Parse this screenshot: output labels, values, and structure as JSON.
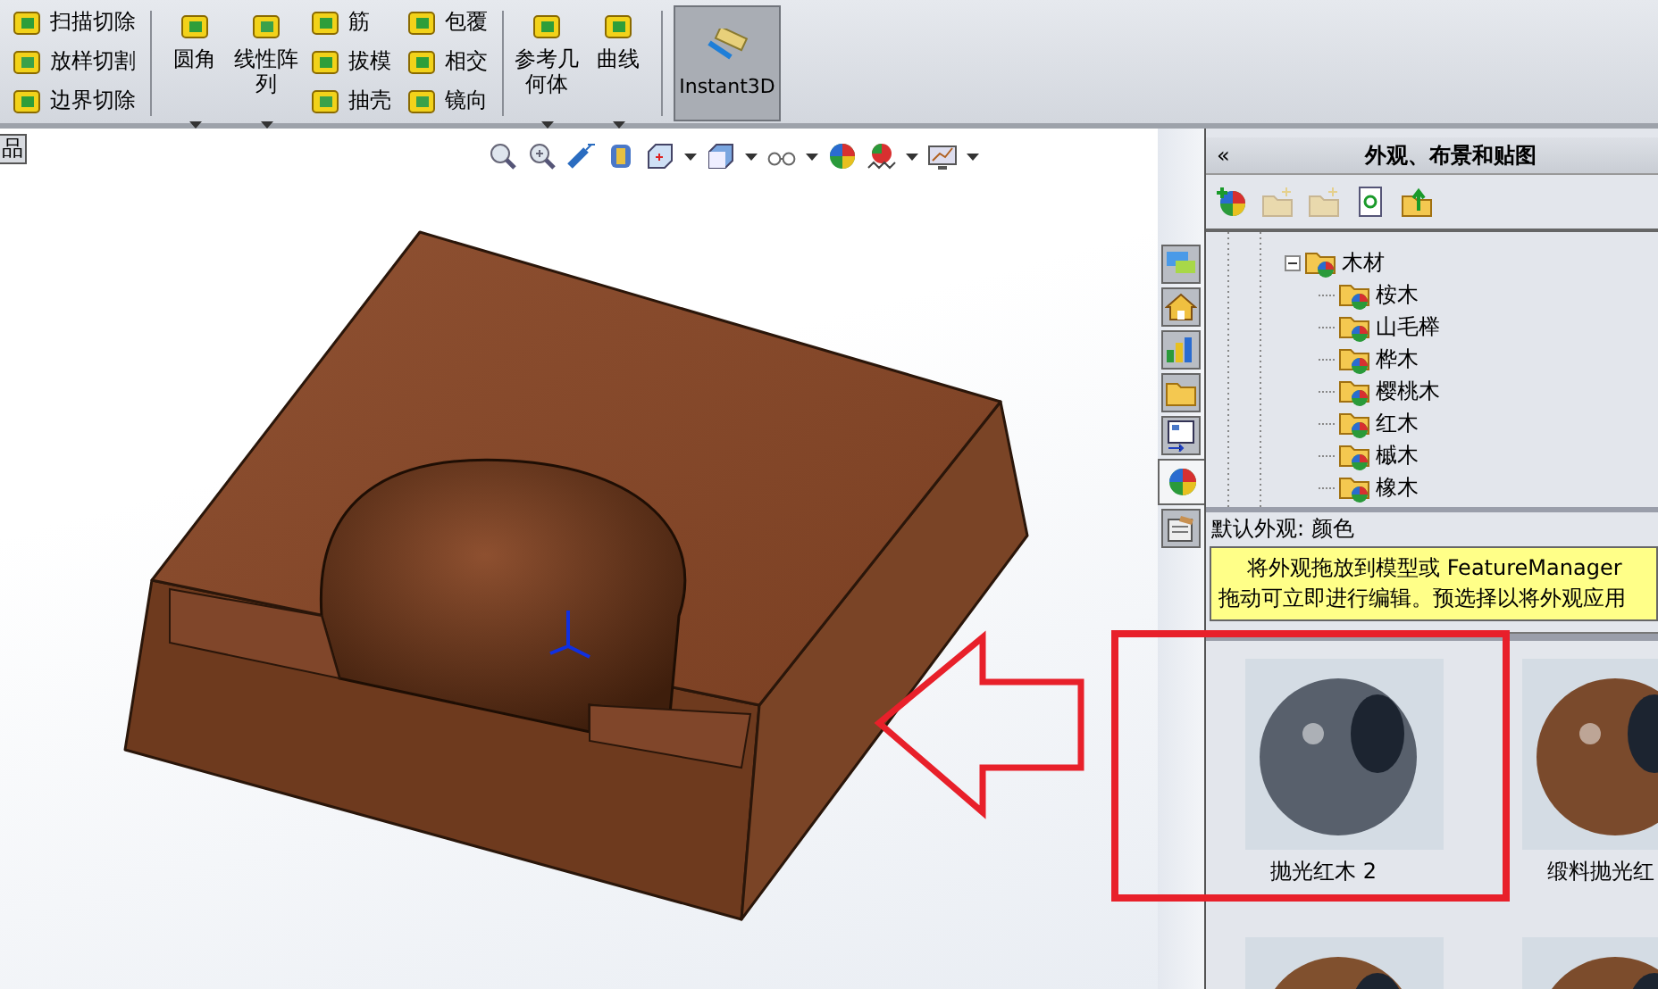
{
  "ribbon": [
    {
      "kind": "stack",
      "items": [
        {
          "label": "扫描切除"
        },
        {
          "label": "放样切割"
        },
        {
          "label": "边界切除"
        }
      ]
    },
    {
      "kind": "separator"
    },
    {
      "kind": "large",
      "label": "圆角",
      "dropdown": true
    },
    {
      "kind": "large",
      "label": "线性阵列",
      "dropdown": true
    },
    {
      "kind": "stack",
      "items": [
        {
          "label": "筋"
        },
        {
          "label": "拔模"
        },
        {
          "label": "抽壳"
        }
      ]
    },
    {
      "kind": "stack",
      "items": [
        {
          "label": "包覆"
        },
        {
          "label": "相交"
        },
        {
          "label": "镜向"
        }
      ]
    },
    {
      "kind": "separator"
    },
    {
      "kind": "large",
      "label": "参考几何体",
      "dropdown": true
    },
    {
      "kind": "large",
      "label": "曲线",
      "dropdown": true
    },
    {
      "kind": "separator"
    },
    {
      "kind": "toggle",
      "label": "Instant3D",
      "selected": true
    }
  ],
  "viewport": {
    "tab_label": "品"
  },
  "side_tabs": [
    {
      "selected": false
    },
    {
      "selected": false
    },
    {
      "selected": false
    },
    {
      "selected": false
    },
    {
      "selected": false
    },
    {
      "selected": true
    },
    {
      "selected": false
    }
  ],
  "task_pane": {
    "collapse_glyph": "«",
    "title": "外观、布景和贴图",
    "toolbar": [
      {
        "disabled": false
      },
      {
        "disabled": true
      },
      {
        "disabled": true
      },
      {
        "disabled": false
      },
      {
        "disabled": false
      }
    ],
    "tree": [
      {
        "label": "木材",
        "expanded": true,
        "children": [
          {
            "label": "桉木"
          },
          {
            "label": "山毛榉"
          },
          {
            "label": "桦木"
          },
          {
            "label": "樱桃木"
          },
          {
            "label": "红木"
          },
          {
            "label": "槭木"
          },
          {
            "label": "橡木"
          }
        ]
      }
    ],
    "selection_label": "默认外观: 颜色",
    "hint_lines": [
      "将外观拖放到模型或 FeatureManager",
      "拖动可立即进行编辑。预选择以将外观应用"
    ],
    "thumbnails": [
      {
        "label": "抛光红木 2",
        "color": "#58606c"
      },
      {
        "label": "缎料抛光红",
        "color": "#7a4a2c"
      },
      {
        "color": "#80502e"
      },
      {
        "color": "#7c4c2c"
      }
    ]
  }
}
